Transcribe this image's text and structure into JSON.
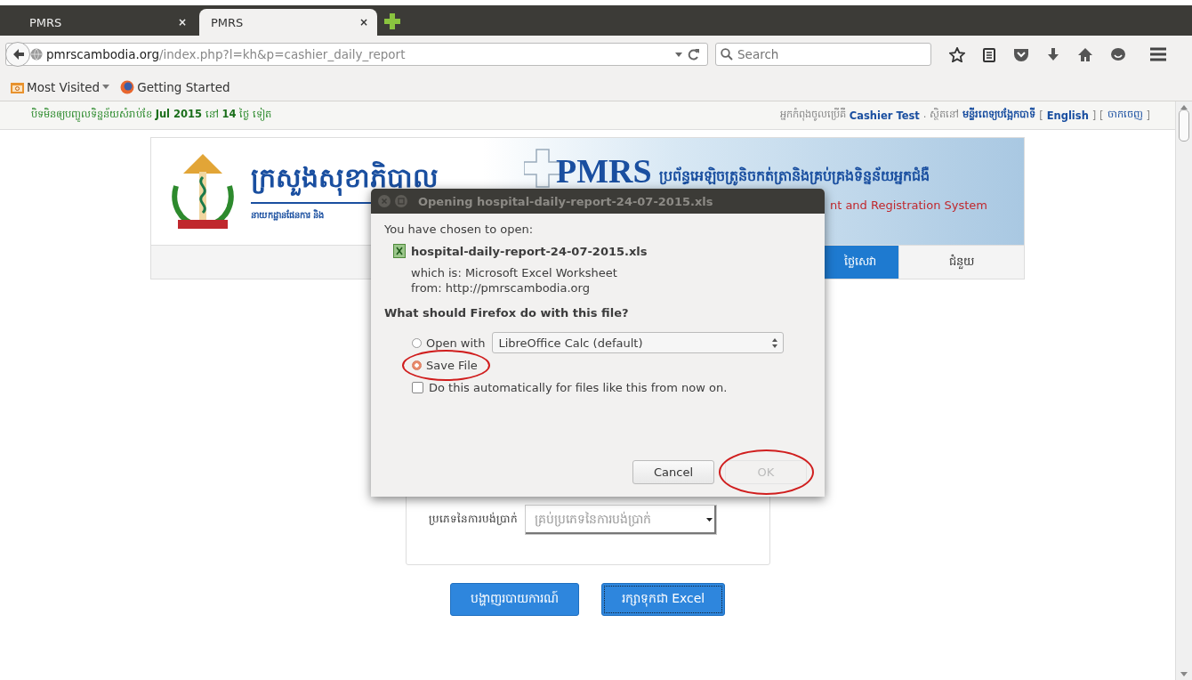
{
  "browser": {
    "tabs": [
      {
        "title": "PMRS",
        "close": "×",
        "selected": false
      },
      {
        "title": "PMRS",
        "close": "×",
        "selected": true
      }
    ],
    "url": {
      "host": "pmrscambodia.org",
      "path": "/index.php?l=kh&p=cashier_daily_report"
    },
    "search": {
      "placeholder": "Search"
    },
    "bookmarks": [
      {
        "label": "Most Visited",
        "kind": "folder"
      },
      {
        "label": "Getting Started",
        "kind": "link"
      }
    ]
  },
  "notice": "បិទមិនឲ្យបញ្ចូលទិន្នន័យសំរាប់ខែ **Jul 2015** នៅ **14** ថ្ងៃ ទៀត",
  "user_bar": [
    {
      "text": "អ្នកកំពុងចូលប្រើគឺ",
      "kind": "text"
    },
    {
      "text": "Cashier Test",
      "kind": "bold_link"
    },
    {
      "text": ". ស្ថិតនៅ",
      "kind": "text"
    },
    {
      "text": "មន្ទីរពេទ្យបង្អែកបាទី",
      "kind": "bold_link"
    },
    {
      "text": "[",
      "kind": "text"
    },
    {
      "text": "English",
      "kind": "bold_link"
    },
    {
      "text": "] [",
      "kind": "text"
    },
    {
      "text": "ចាកចេញ",
      "kind": "link"
    },
    {
      "text": "]",
      "kind": "text"
    }
  ],
  "header": {
    "ministry": "ក្រសួងសុខាភិបាល",
    "department": "នាយកដ្ឋានផែនការ និង",
    "system_name": "PMRS",
    "system_title_km": "ប្រព័ន្ធអេឡិចត្រូនិចកត់ត្រានិងគ្រប់គ្រងទិន្នន័យអ្នកជំងឺ",
    "system_title_en": "nt and Registration System"
  },
  "nav": [
    {
      "label": "ថ្លៃសេវា",
      "selected": true
    },
    {
      "label": "ជំនួយ",
      "selected": false
    }
  ],
  "form": {
    "payment_type": {
      "label": "ប្រភេទនៃការបង់ប្រាក់",
      "value": "គ្រប់ប្រភេទនៃការបង់ប្រាក់"
    }
  },
  "actions": [
    {
      "label": "បង្ហាញរបាយការណ៍",
      "focused": false
    },
    {
      "label": "រក្សាទុកជា Excel",
      "focused": true
    }
  ],
  "dialog": {
    "title": "Opening hospital-daily-report-24-07-2015.xls",
    "intro": "You have chosen to open:",
    "filename": "hospital-daily-report-24-07-2015.xls",
    "type_line": "which is:  Microsoft Excel Worksheet",
    "from_line": "from:  http://pmrscambodia.org",
    "question": "What should Firefox do with this file?",
    "options": [
      {
        "label": "Open with",
        "selected": false,
        "circled": false
      },
      {
        "label": "Save File",
        "selected": true,
        "circled": true
      }
    ],
    "app_select": "LibreOffice Calc (default)",
    "remember": {
      "label": "Do this automatically for files like this from now on.",
      "checked": false
    },
    "buttons": [
      {
        "label": "Cancel",
        "disabled": false,
        "circled": false
      },
      {
        "label": "OK",
        "disabled": true,
        "circled": true
      }
    ]
  }
}
